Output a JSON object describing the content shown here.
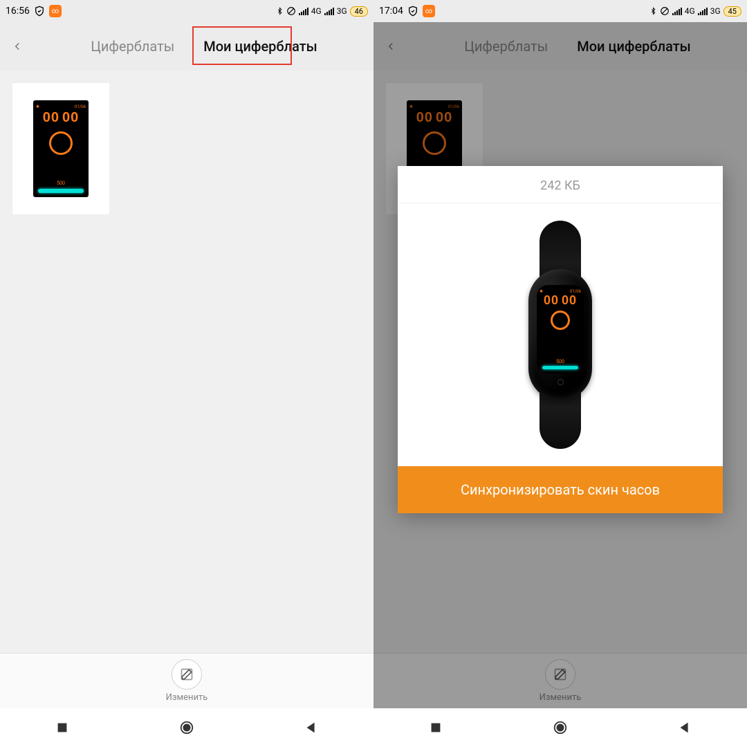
{
  "left": {
    "status": {
      "time": "16:56",
      "battery": "46",
      "net1": "4G",
      "net2": "3G"
    },
    "tabs": {
      "watchfaces": "Циферблаты",
      "my_watchfaces": "Мои циферблаты"
    },
    "footer": {
      "edit": "Изменить"
    },
    "watchface": {
      "date": "01/06",
      "time_h": "00",
      "time_m": "00",
      "steps": "500"
    }
  },
  "right": {
    "status": {
      "time": "17:04",
      "battery": "45",
      "net1": "4G",
      "net2": "3G"
    },
    "tabs": {
      "watchfaces": "Циферблаты",
      "my_watchfaces": "Мои циферблаты"
    },
    "footer": {
      "edit": "Изменить"
    },
    "watchface": {
      "date": "01/06",
      "time_h": "00",
      "time_m": "00",
      "steps": "500"
    },
    "modal": {
      "size": "242 КБ",
      "sync": "Синхронизировать скин часов"
    }
  }
}
